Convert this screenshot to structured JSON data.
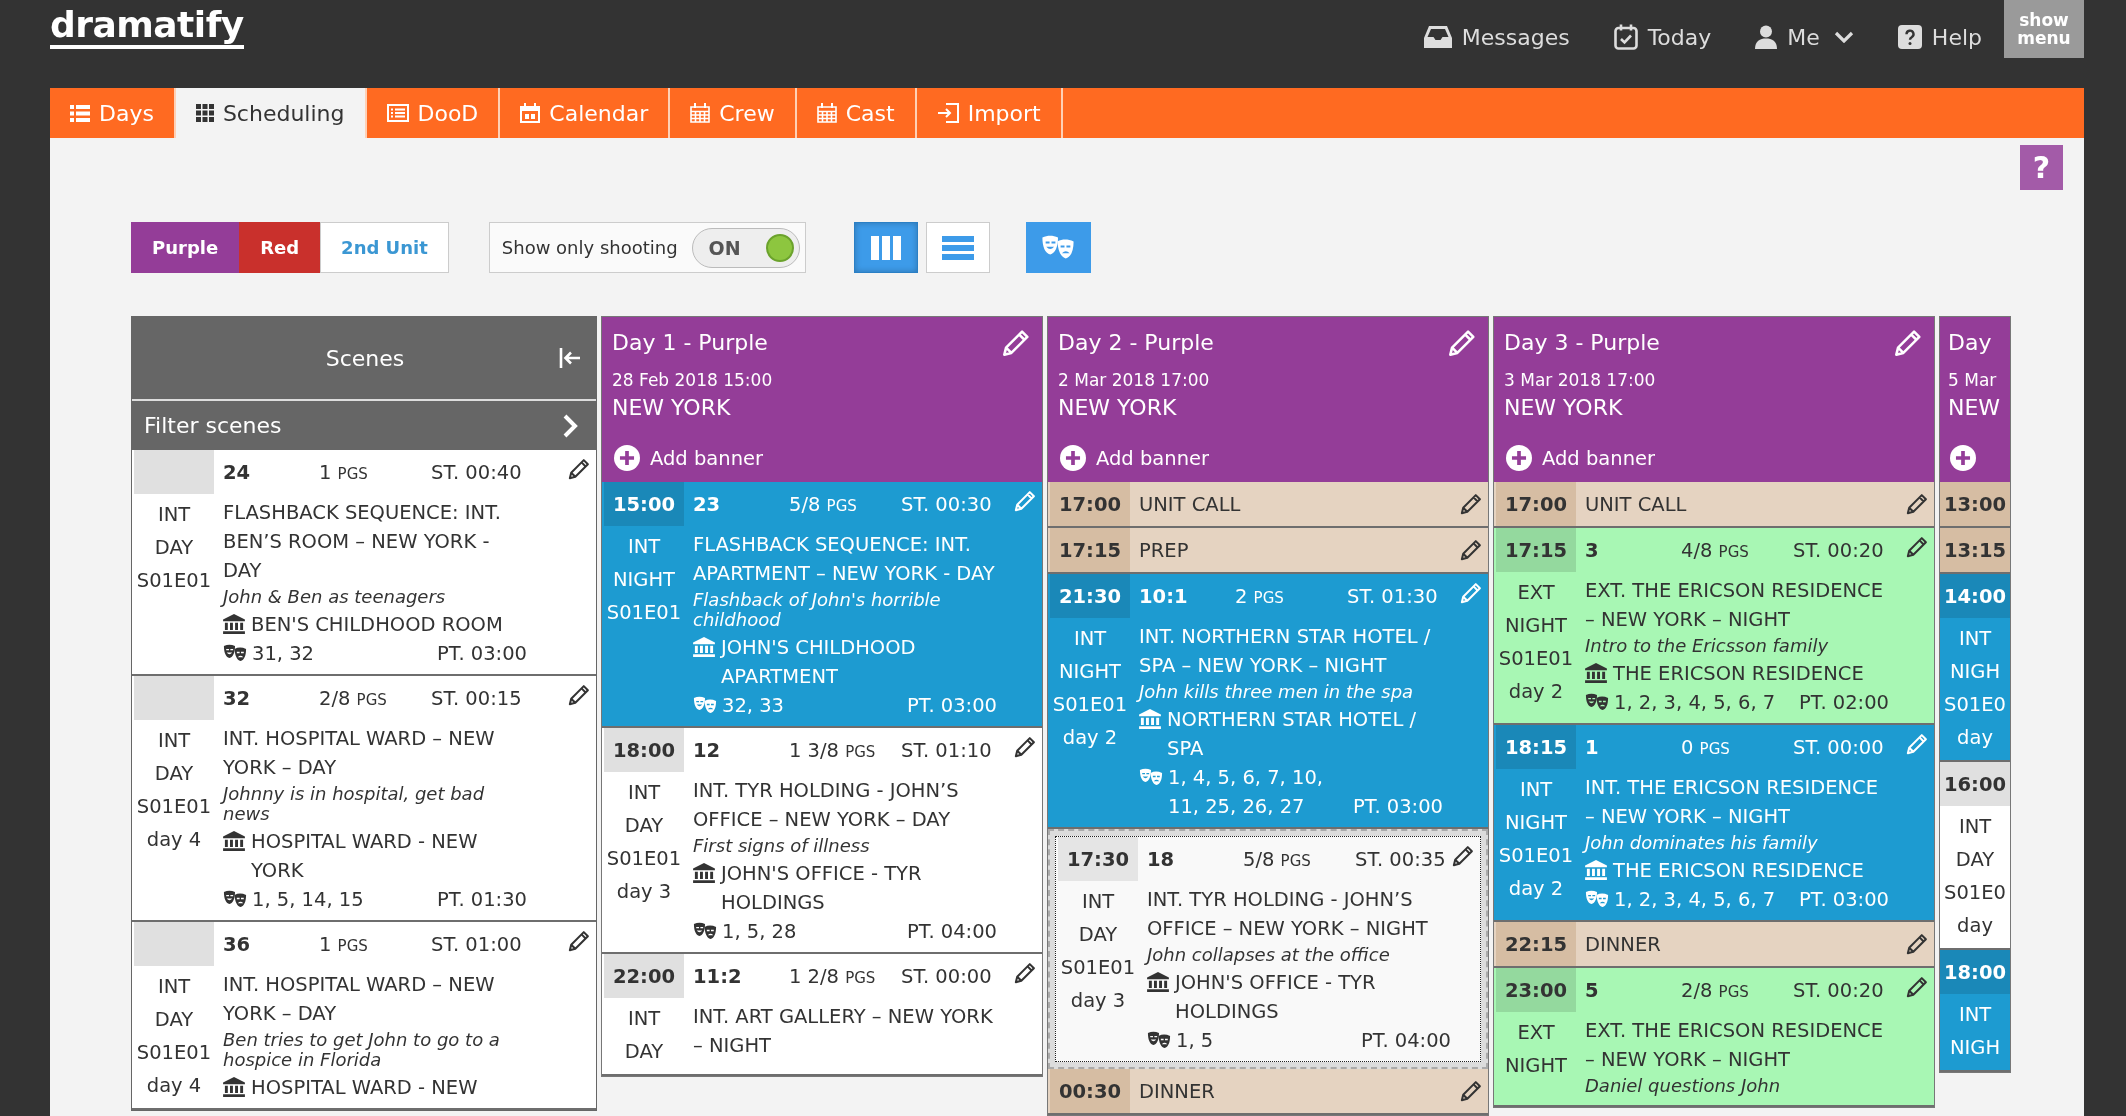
{
  "top_bar": {
    "logo": "dramatify",
    "links": [
      {
        "label": "Messages"
      },
      {
        "label": "Today"
      },
      {
        "label": "Me"
      },
      {
        "label": "Help"
      }
    ],
    "menu_button": "show menu"
  },
  "nav_tabs": [
    {
      "label": "Days",
      "selected": false
    },
    {
      "label": "Scheduling",
      "selected": true
    },
    {
      "label": "DooD",
      "selected": false
    },
    {
      "label": "Calendar",
      "selected": false
    },
    {
      "label": "Crew",
      "selected": false
    },
    {
      "label": "Cast",
      "selected": false
    },
    {
      "label": "Import",
      "selected": false
    }
  ],
  "help_button": "?",
  "unit_filter": [
    {
      "label": "Purple",
      "color": "#943d98",
      "selected": true
    },
    {
      "label": "Red",
      "color": "#c9302c",
      "selected": true
    },
    {
      "label": "2nd Unit",
      "color": "#3b97d3",
      "selected": false
    }
  ],
  "shooting_toggle": {
    "label": "Show only shooting",
    "state_label": "ON",
    "on": true
  },
  "view_buttons": [
    {
      "kind": "columns",
      "selected": true
    },
    {
      "kind": "list",
      "selected": false
    }
  ],
  "scenes_panel": {
    "title": "Scenes",
    "filter_label": "Filter scenes",
    "scenes": [
      {
        "number": "24",
        "pages": "1",
        "pages_unit": "PGS",
        "screen_time": "ST. 00:40",
        "int_ext": "INT",
        "day_night": "DAY",
        "episode": "S01E01",
        "slugline": "FLASHBACK SEQUENCE: INT. BEN’S ROOM – NEW YORK - DAY",
        "synopsis": "John & Ben as teenagers",
        "set": "BEN'S CHILDHOOD ROOM",
        "cast": "31, 32",
        "prod_time": "PT. 03:00"
      },
      {
        "number": "32",
        "pages": "2/8",
        "pages_unit": "PGS",
        "screen_time": "ST. 00:15",
        "int_ext": "INT",
        "day_night": "DAY",
        "episode": "S01E01",
        "story_day": "day 4",
        "slugline": "INT. HOSPITAL WARD – NEW YORK – DAY",
        "synopsis": "Johnny is in hospital, get bad news",
        "set": "HOSPITAL WARD - NEW YORK",
        "cast": "1, 5, 14, 15",
        "prod_time": "PT. 01:30"
      },
      {
        "number": "36",
        "pages": "1",
        "pages_unit": "PGS",
        "screen_time": "ST. 01:00",
        "int_ext": "INT",
        "day_night": "DAY",
        "episode": "S01E01",
        "story_day": "day 4",
        "slugline": "INT. HOSPITAL WARD – NEW YORK – DAY",
        "synopsis": "Ben tries to get John to go to a hospice in Florida",
        "set": "HOSPITAL WARD - NEW"
      }
    ]
  },
  "days": [
    {
      "kind": "full",
      "title": "Day 1 - Purple",
      "date": "28 Feb 2018 15:00",
      "location": "NEW YORK",
      "add_banner": "Add banner",
      "rows": [
        {
          "kind": "scene",
          "color": "#1d9bd1",
          "time": "15:00",
          "number": "23",
          "pages": "5/8",
          "pages_unit": "PGS",
          "screen_time": "ST. 00:30",
          "int_ext": "INT",
          "day_night": "NIGHT",
          "episode": "S01E01",
          "slugline": "FLASHBACK SEQUENCE: INT. APARTMENT – NEW YORK - DAY",
          "synopsis": "Flashback of John's horrible childhood",
          "set": "JOHN'S CHILDHOOD APARTMENT",
          "cast": "32, 33",
          "prod_time": "PT. 03:00"
        },
        {
          "kind": "scene",
          "color": "#ffffff",
          "time": "18:00",
          "number": "12",
          "pages": "1 3/8",
          "pages_unit": "PGS",
          "screen_time": "ST. 01:10",
          "int_ext": "INT",
          "day_night": "DAY",
          "episode": "S01E01",
          "story_day": "day 3",
          "slugline": "INT. TYR HOLDING - JOHN’S OFFICE – NEW YORK – DAY",
          "synopsis": "First signs of illness",
          "set": "JOHN'S OFFICE - TYR HOLDINGS",
          "cast": "1, 5, 28",
          "prod_time": "PT. 04:00"
        },
        {
          "kind": "scene",
          "color": "#ffffff",
          "time": "22:00",
          "number": "11:2",
          "pages": "1 2/8",
          "pages_unit": "PGS",
          "screen_time": "ST. 00:00",
          "int_ext": "INT",
          "day_night": "DAY",
          "slugline": "INT. ART GALLERY – NEW YORK – NIGHT"
        }
      ]
    },
    {
      "kind": "full",
      "title": "Day 2 - Purple",
      "date": "2 Mar 2018 17:00",
      "location": "NEW YORK",
      "add_banner": "Add banner",
      "rows": [
        {
          "kind": "event",
          "time": "17:00",
          "label": "UNIT CALL"
        },
        {
          "kind": "event",
          "time": "17:15",
          "label": "PREP"
        },
        {
          "kind": "scene",
          "color": "#1d9bd1",
          "time": "21:30",
          "number": "10:1",
          "pages": "2",
          "pages_unit": "PGS",
          "screen_time": "ST. 01:30",
          "int_ext": "INT",
          "day_night": "NIGHT",
          "episode": "S01E01",
          "story_day": "day 2",
          "slugline": "INT. NORTHERN STAR HOTEL / SPA – NEW YORK – NIGHT",
          "synopsis": "John kills three men in the spa",
          "set": "NORTHERN STAR HOTEL / SPA",
          "cast": "1, 4, 5, 6, 7, 10, 11, 25, 26, 27",
          "prod_time": "PT. 03:00"
        },
        {
          "kind": "drop_zone"
        },
        {
          "kind": "event",
          "time": "00:30",
          "label": "DINNER"
        }
      ]
    },
    {
      "kind": "full",
      "title": "Day 3 - Purple",
      "date": "3 Mar 2018 17:00",
      "location": "NEW YORK",
      "add_banner": "Add banner",
      "rows": [
        {
          "kind": "event",
          "time": "17:00",
          "label": "UNIT CALL"
        },
        {
          "kind": "scene",
          "color": "#a8f7b4",
          "time": "17:15",
          "number": "3",
          "pages": "4/8",
          "pages_unit": "PGS",
          "screen_time": "ST. 00:20",
          "int_ext": "EXT",
          "day_night": "NIGHT",
          "episode": "S01E01",
          "story_day": "day 2",
          "slugline": "EXT. THE ERICSON RESIDENCE – NEW YORK – NIGHT",
          "synopsis": "Intro to the Ericsson family",
          "set": "THE ERICSON RESIDENCE",
          "cast": "1, 2, 3, 4, 5, 6, 7",
          "prod_time": "PT. 02:00"
        },
        {
          "kind": "scene",
          "color": "#1d9bd1",
          "time": "18:15",
          "number": "1",
          "pages": "0",
          "pages_unit": "PGS",
          "screen_time": "ST. 00:00",
          "int_ext": "INT",
          "day_night": "NIGHT",
          "episode": "S01E01",
          "story_day": "day 2",
          "slugline": "INT. THE ERICSON RESIDENCE – NEW YORK – NIGHT",
          "synopsis": "John dominates his family",
          "set": "THE ERICSON RESIDENCE",
          "cast": "1, 2, 3, 4, 5, 6, 7",
          "prod_time": "PT. 03:00"
        },
        {
          "kind": "event",
          "time": "22:15",
          "label": "DINNER"
        },
        {
          "kind": "scene",
          "color": "#a8f7b4",
          "time": "23:00",
          "number": "5",
          "pages": "2/8",
          "pages_unit": "PGS",
          "screen_time": "ST. 00:20",
          "int_ext": "EXT",
          "day_night": "NIGHT",
          "slugline": "EXT. THE ERICSON RESIDENCE – NEW YORK – NIGHT",
          "synopsis": "Daniel questions John"
        }
      ]
    },
    {
      "kind": "clipped",
      "title": "Day",
      "date": "5 Mar",
      "location": "NEW",
      "rows": [
        {
          "kind": "event",
          "time": "13:00"
        },
        {
          "kind": "event",
          "time": "13:15"
        },
        {
          "kind": "scene",
          "color": "#1d9bd1",
          "time": "14:00",
          "int_ext": "INT",
          "day_night": "NIGH",
          "episode": "S01E0",
          "story_day": "day"
        },
        {
          "kind": "scene",
          "color": "#ffffff",
          "time": "16:00",
          "int_ext": "INT",
          "day_night": "DAY",
          "episode": "S01E0",
          "story_day": "day"
        },
        {
          "kind": "scene",
          "color": "#1d9bd1",
          "time": "18:00",
          "int_ext": "INT",
          "day_night": "NIGH"
        }
      ]
    }
  ],
  "dragged_scene": {
    "time": "17:30",
    "number": "18",
    "pages": "5/8",
    "pages_unit": "PGS",
    "screen_time": "ST. 00:35",
    "int_ext": "INT",
    "day_night": "DAY",
    "episode": "S01E01",
    "story_day": "day 3",
    "slugline": "INT. TYR HOLDING - JOHN’S OFFICE – NEW YORK – NIGHT",
    "synopsis": "John collapses at the office",
    "set": "JOHN'S OFFICE - TYR HOLDINGS",
    "cast": "1, 5",
    "prod_time": "PT. 04:00"
  }
}
